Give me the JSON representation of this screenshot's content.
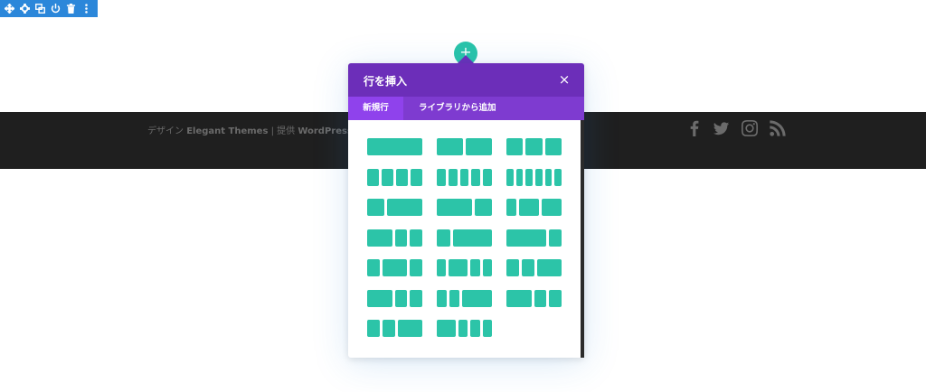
{
  "toolbar": {
    "buttons": [
      {
        "name": "move-icon"
      },
      {
        "name": "gear-icon"
      },
      {
        "name": "duplicate-icon"
      },
      {
        "name": "power-icon"
      },
      {
        "name": "trash-icon"
      },
      {
        "name": "more-icon"
      }
    ]
  },
  "footer": {
    "credit_prefix": "デザイン ",
    "credit_brand1": "Elegant Themes",
    "credit_sep": " | 提供 ",
    "credit_brand2": "WordPress",
    "social": [
      "facebook-icon",
      "twitter-icon",
      "instagram-icon",
      "rss-icon"
    ]
  },
  "add_button": {
    "label": "+"
  },
  "modal": {
    "title": "行を挿入",
    "close": "×",
    "tabs": [
      {
        "label": "新規行",
        "active": true
      },
      {
        "label": "ライブラリから追加",
        "active": false
      }
    ],
    "layouts": [
      [
        1
      ],
      [
        1,
        1
      ],
      [
        1,
        1,
        1
      ],
      [
        1,
        1,
        1,
        1
      ],
      [
        1,
        1,
        1,
        1,
        1
      ],
      [
        1,
        1,
        1,
        1,
        1,
        1
      ],
      [
        1,
        2
      ],
      [
        2,
        1
      ],
      [
        1,
        2,
        2
      ],
      [
        2,
        1,
        1
      ],
      [
        1,
        3
      ],
      [
        3,
        1
      ],
      [
        1,
        2,
        1
      ],
      [
        1,
        2,
        1,
        1
      ],
      [
        1,
        1,
        2
      ],
      [
        2,
        1,
        1
      ],
      [
        1,
        1,
        3
      ],
      [
        2,
        1,
        1
      ],
      [
        1,
        1,
        2
      ],
      [
        2,
        1,
        1,
        1
      ]
    ],
    "colors": {
      "header": "#6c2eb9",
      "tabs": "#7e3bd0",
      "active_tab": "#8f42ec",
      "column": "#2cc4a8"
    }
  }
}
